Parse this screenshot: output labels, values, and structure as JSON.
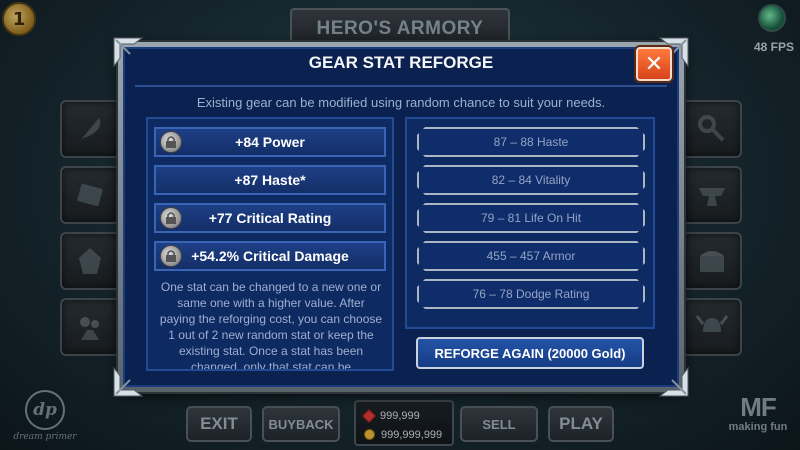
{
  "hud": {
    "screen_title": "HERO'S ARMORY",
    "fps_label": "48 FPS",
    "top_left_badge": "1"
  },
  "bottom_bar": {
    "exit": "EXIT",
    "buyback": "BUYBACK",
    "sell": "SELL",
    "play": "PLAY",
    "gems": "999,999",
    "gold": "999,999,999"
  },
  "logos": {
    "left_mark": "dp",
    "left_text": "dream primer",
    "right_mark": "MF",
    "right_text": "making fun"
  },
  "modal": {
    "title": "GEAR STAT REFORGE",
    "description": "Existing gear can be modified using random chance to suit your needs.",
    "close_glyph": "✕",
    "current_stats": [
      {
        "label": "+84 Power",
        "locked": true
      },
      {
        "label": "+87 Haste*",
        "locked": false
      },
      {
        "label": "+77 Critical Rating",
        "locked": true
      },
      {
        "label": "+54.2% Critical Damage",
        "locked": true
      }
    ],
    "help_text": "One stat can be changed to a new one or same one with a higher value. After paying the reforging cost, you can choose 1 out of 2 new random stat or keep the existing stat. Once a stat has been changed, only that stat can be",
    "options": [
      "87 – 88 Haste",
      "82 – 84 Vitality",
      "79 – 81 Life On Hit",
      "455 – 457 Armor",
      "76 – 78 Dodge Rating"
    ],
    "reforge_label": "REFORGE AGAIN (20000 Gold)"
  },
  "colors": {
    "modal_bg": "#0b2150",
    "stat_button": "#1d3f86",
    "close_button": "#e8541f"
  }
}
